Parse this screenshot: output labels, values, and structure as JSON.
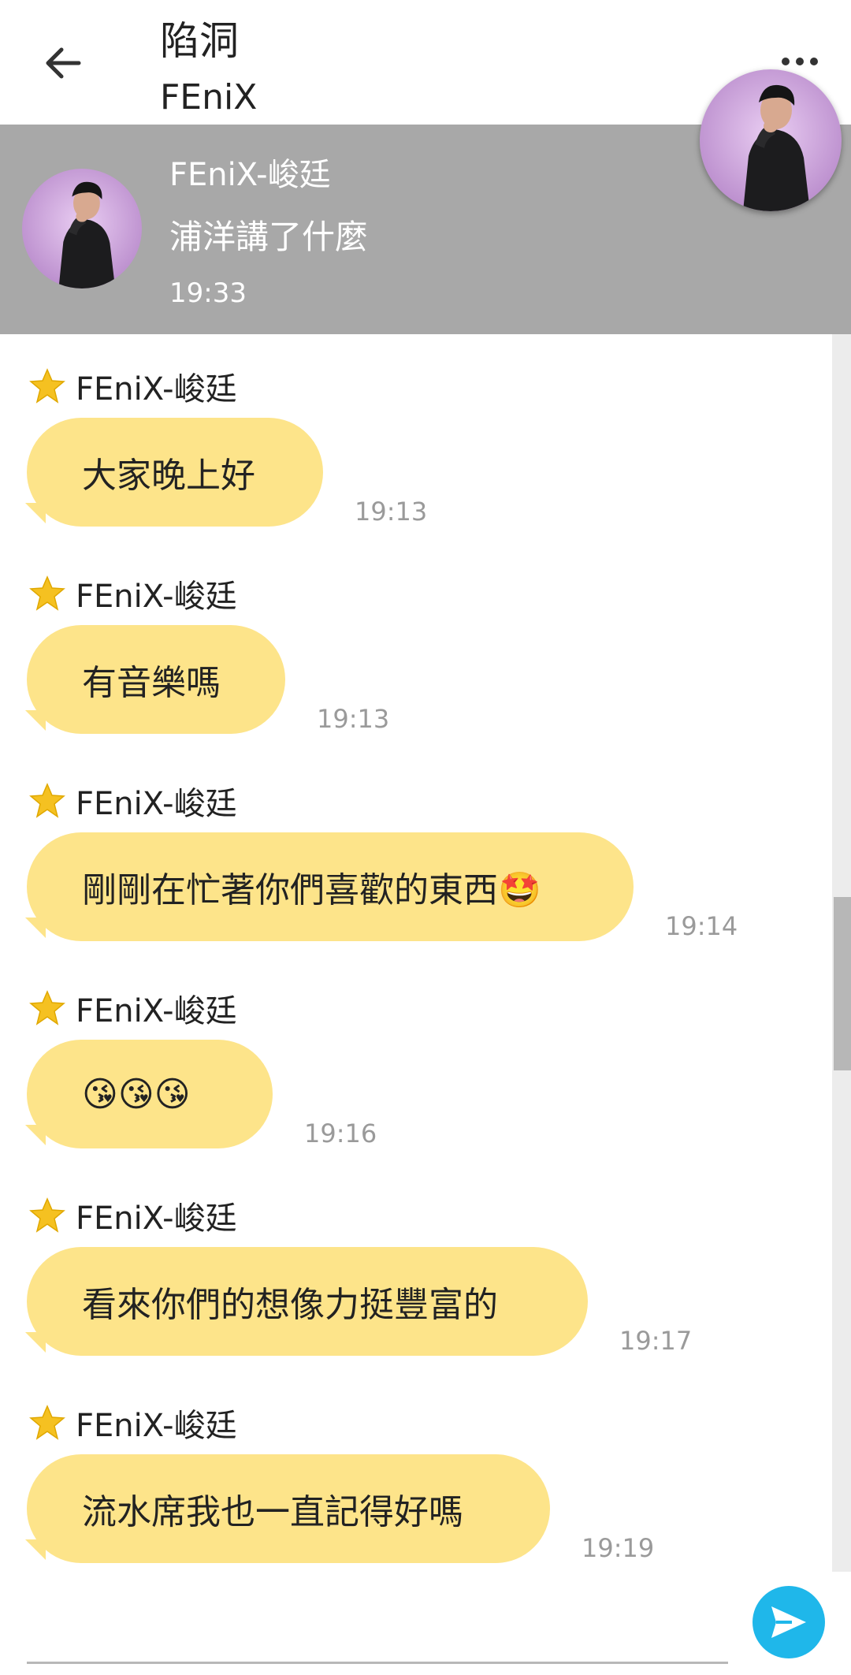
{
  "header": {
    "title": "陷洞",
    "subtitle": "FEniX",
    "back_icon": "arrow-left-icon",
    "more_icon": "more-horizontal-icon"
  },
  "pinned": {
    "name": "FEniX-峻廷",
    "text": "浦洋講了什麼",
    "time": "19:33"
  },
  "messages": [
    {
      "sender": "FEniX-峻廷",
      "text": "大家晚上好",
      "time": "19:13"
    },
    {
      "sender": "FEniX-峻廷",
      "text": "有音樂嗎",
      "time": "19:13"
    },
    {
      "sender": "FEniX-峻廷",
      "text": "剛剛在忙著你們喜歡的東西🤩",
      "time": "19:14"
    },
    {
      "sender": "FEniX-峻廷",
      "text": "😘😘😘",
      "time": "19:16"
    },
    {
      "sender": "FEniX-峻廷",
      "text": "看來你們的想像力挺豐富的",
      "time": "19:17"
    },
    {
      "sender": "FEniX-峻廷",
      "text": "流水席我也一直記得好嗎",
      "time": "19:19"
    }
  ],
  "colors": {
    "bubble": "#fde48a",
    "pinned_bg": "#a8a8a8",
    "send_button": "#1fb7ea",
    "star": "#f5c121"
  },
  "composer": {
    "send_icon": "send-icon"
  }
}
